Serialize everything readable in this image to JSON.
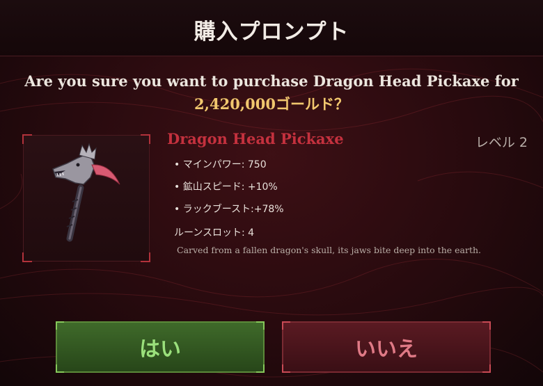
{
  "dialog": {
    "title": "購入プロンプト",
    "question_prefix": "Are you sure you want to purchase Dragon Head Pickaxe for",
    "price_text": "2,420,000ゴールド？"
  },
  "item": {
    "name": "Dragon Head Pickaxe",
    "level": "レベル 2",
    "stats": [
      "• マインパワー: 750",
      "• 鉱山スピード: +10%",
      "• ラックブースト:+78%",
      "ルーンスロット: 4"
    ],
    "description": "Carved from a fallen dragon's skull, its jaws bite deep into the earth."
  },
  "buttons": {
    "yes_label": "はい",
    "no_label": "いいえ"
  },
  "colors": {
    "item_name": "#c4313e",
    "price": "#f1c76e",
    "yes_text": "#9be07c",
    "no_text": "#e07a86"
  }
}
